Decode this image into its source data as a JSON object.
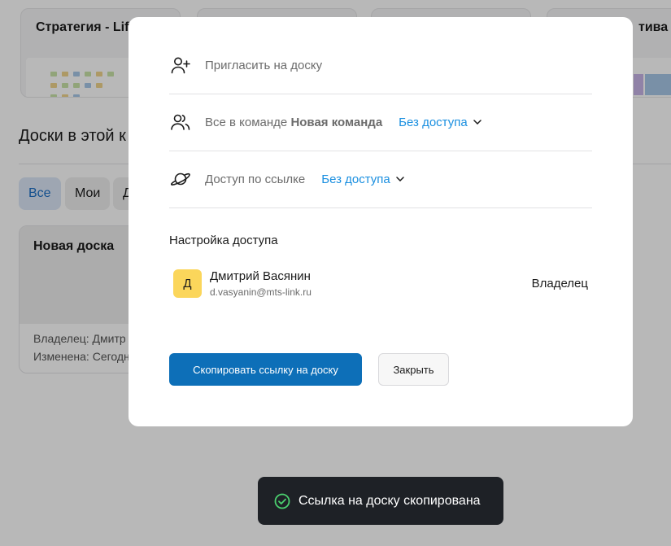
{
  "background": {
    "boards_top": [
      {
        "title": "Стратегия - Lif"
      },
      {
        "title": ""
      },
      {
        "title": ""
      },
      {
        "title": "тива"
      }
    ],
    "section_title": "Доски в этой к",
    "filters": [
      "Все",
      "Мои",
      "Д"
    ],
    "board_card": {
      "name": "Новая доска",
      "owner": "Владелец: Дмитр",
      "modified": "Изменена: Сегодн"
    }
  },
  "modal": {
    "invite_label": "Пригласить на доску",
    "team_row": {
      "prefix": "Все в команде",
      "team_name": "Новая команда",
      "access": "Без доступа"
    },
    "link_row": {
      "label": "Доступ по ссылке",
      "access": "Без доступа"
    },
    "settings_title": "Настройка доступа",
    "user": {
      "initial": "Д",
      "name": "Дмитрий Васянин",
      "email": "d.vasyanin@mts-link.ru",
      "role": "Владелец"
    },
    "copy_button": "Скопировать ссылку на доску",
    "close_button": "Закрыть"
  },
  "toast": {
    "message": "Ссылка на доску скопирована"
  },
  "colors": {
    "accent": "#1a8fe0",
    "primary_button": "#0d6fb8",
    "avatar": "#fbd65b",
    "toast_bg": "#1e2126",
    "toast_icon": "#4bd06f"
  },
  "icons": {
    "invite": "user-plus-icon",
    "team": "users-icon",
    "link": "planet-icon",
    "chevron": "chevron-down-icon",
    "toast": "check-circle-icon"
  }
}
